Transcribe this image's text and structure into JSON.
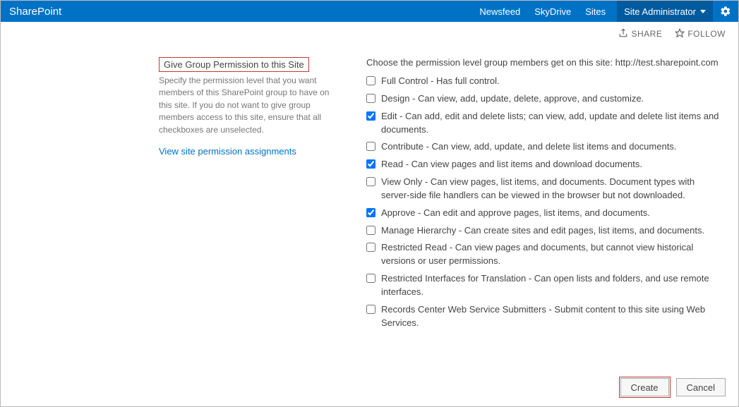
{
  "header": {
    "brand": "SharePoint",
    "nav": [
      "Newsfeed",
      "SkyDrive",
      "Sites"
    ],
    "user": "Site Administrator"
  },
  "subbar": {
    "share": "SHARE",
    "follow": "FOLLOW"
  },
  "left": {
    "title": "Give Group Permission to this Site",
    "desc": "Specify the permission level that you want members of this SharePoint group to have on this site. If you do not want to give group members access to this site, ensure that all checkboxes are unselected.",
    "link": "View site permission assignments"
  },
  "right": {
    "prompt": "Choose the permission level group members get on this site: http://test.sharepoint.com",
    "permissions": [
      {
        "checked": false,
        "label": "Full Control - Has full control."
      },
      {
        "checked": false,
        "label": "Design - Can view, add, update, delete, approve, and customize."
      },
      {
        "checked": true,
        "label": "Edit - Can add, edit and delete lists; can view, add, update and delete list items and documents."
      },
      {
        "checked": false,
        "label": "Contribute - Can view, add, update, and delete list items and documents."
      },
      {
        "checked": true,
        "label": "Read - Can view pages and list items and download documents."
      },
      {
        "checked": false,
        "label": "View Only - Can view pages, list items, and documents. Document types with server-side file handlers can be viewed in the browser but not downloaded."
      },
      {
        "checked": true,
        "label": "Approve - Can edit and approve pages, list items, and documents."
      },
      {
        "checked": false,
        "label": "Manage Hierarchy - Can create sites and edit pages, list items, and documents."
      },
      {
        "checked": false,
        "label": "Restricted Read - Can view pages and documents, but cannot view historical versions or user permissions."
      },
      {
        "checked": false,
        "label": "Restricted Interfaces for Translation - Can open lists and folders, and use remote interfaces."
      },
      {
        "checked": false,
        "label": "Records Center Web Service Submitters - Submit content to this site using Web Services."
      }
    ]
  },
  "footer": {
    "create": "Create",
    "cancel": "Cancel"
  }
}
